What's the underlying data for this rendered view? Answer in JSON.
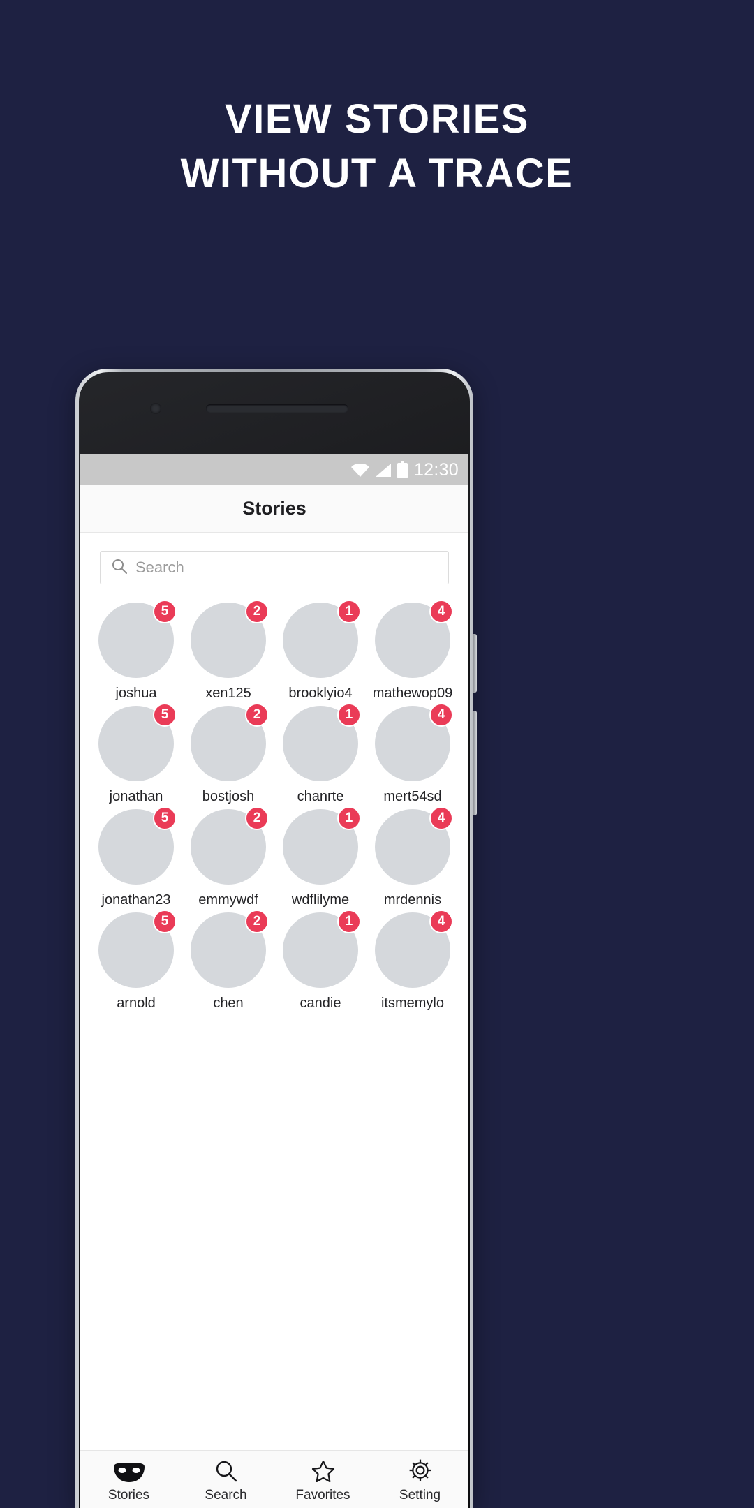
{
  "promo": {
    "headline_line1": "VIEW STORIES",
    "headline_line2": "WITHOUT A TRACE",
    "background_color": "#1e2142",
    "text_color": "#ffffff"
  },
  "status_bar": {
    "time": "12:30",
    "icons": [
      "wifi-icon",
      "signal-icon",
      "battery-icon"
    ],
    "background_color": "#c8c8c8"
  },
  "app_bar": {
    "title": "Stories"
  },
  "search": {
    "placeholder": "Search",
    "value": "",
    "icon": "search-icon"
  },
  "accent_color": "#ea3b57",
  "stories": [
    {
      "username": "joshua",
      "count": "5"
    },
    {
      "username": "xen125",
      "count": "2"
    },
    {
      "username": "brooklyio4",
      "count": "1"
    },
    {
      "username": "mathewop09",
      "count": "4"
    },
    {
      "username": "jonathan",
      "count": "5"
    },
    {
      "username": "bostjosh",
      "count": "2"
    },
    {
      "username": "chanrte",
      "count": "1"
    },
    {
      "username": "mert54sd",
      "count": "4"
    },
    {
      "username": "jonathan23",
      "count": "5"
    },
    {
      "username": "emmywdf",
      "count": "2"
    },
    {
      "username": "wdflilyme",
      "count": "1"
    },
    {
      "username": "mrdennis",
      "count": "4"
    },
    {
      "username": "arnold",
      "count": "5"
    },
    {
      "username": "chen",
      "count": "2"
    },
    {
      "username": "candie",
      "count": "1"
    },
    {
      "username": "itsmemylo",
      "count": "4"
    }
  ],
  "bottom_nav": [
    {
      "label": "Stories",
      "icon": "mask-icon",
      "active": true
    },
    {
      "label": "Search",
      "icon": "search-icon",
      "active": false
    },
    {
      "label": "Favorites",
      "icon": "star-icon",
      "active": false
    },
    {
      "label": "Setting",
      "icon": "gear-icon",
      "active": false
    }
  ]
}
